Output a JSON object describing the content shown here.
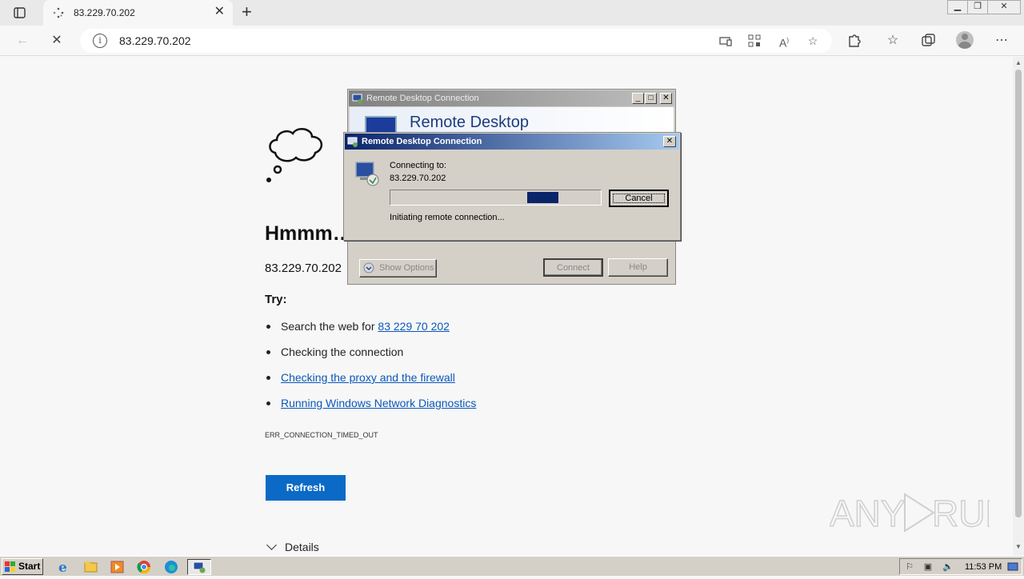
{
  "browser": {
    "tab_title": "83.229.70.202",
    "new_tab_symbol": "+",
    "url": "83.229.70.202"
  },
  "page": {
    "heading": "Hmmm…",
    "address": "83.229.70.202",
    "try_label": "Try:",
    "suggestion_1_prefix": "Search the web for ",
    "suggestion_1_link": "83 229 70 202",
    "suggestion_2": "Checking the connection",
    "suggestion_3": "Checking the proxy and the firewall",
    "suggestion_4": "Running Windows Network Diagnostics",
    "error_code": "ERR_CONNECTION_TIMED_OUT",
    "refresh_label": "Refresh",
    "details_label": "Details",
    "link_color": "#0b57b8",
    "button_color": "#0b6ac6"
  },
  "rdp_back": {
    "title": "Remote Desktop Connection",
    "banner": "Remote Desktop",
    "show_options": "Show Options",
    "connect": "Connect",
    "help": "Help"
  },
  "rdp_dialog": {
    "title": "Remote Desktop Connection",
    "connecting_label": "Connecting to:",
    "host": "83.229.70.202",
    "cancel": "Cancel",
    "status": "Initiating remote connection..."
  },
  "taskbar": {
    "start_label": "Start",
    "clock": "11:53 PM"
  }
}
